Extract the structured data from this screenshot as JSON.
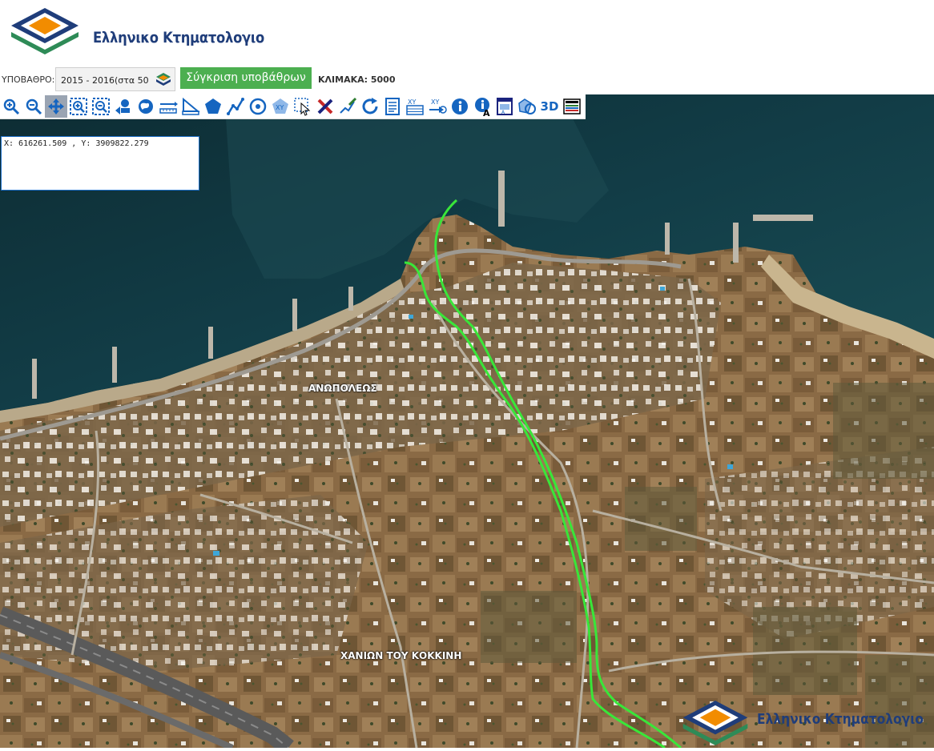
{
  "header": {
    "logo_text": "Ελληνικο Κτηματολογιο"
  },
  "basemap": {
    "label": "ΥΠΟΒΑΘΡΟ:",
    "selected": "2015 - 2016(στα 50",
    "compare_button": "Σύγκριση υποβάθρων",
    "scale": "ΚΛΙΜΑΚΑ: 5000"
  },
  "toolbar": {
    "tools": [
      {
        "name": "zoom-in-icon"
      },
      {
        "name": "zoom-out-icon"
      },
      {
        "name": "pan-icon",
        "active": true
      },
      {
        "name": "zoom-box-in-icon"
      },
      {
        "name": "zoom-box-out-icon"
      },
      {
        "name": "previous-extent-icon"
      },
      {
        "name": "full-extent-icon"
      },
      {
        "name": "measure-distance-icon"
      },
      {
        "name": "measure-angle-icon"
      },
      {
        "name": "measure-area-icon"
      },
      {
        "name": "draw-line-icon"
      },
      {
        "name": "draw-circle-icon"
      },
      {
        "name": "xy-polygon-icon"
      },
      {
        "name": "select-icon"
      },
      {
        "name": "clear-icon"
      },
      {
        "name": "edit-vertex-icon"
      },
      {
        "name": "refresh-icon"
      },
      {
        "name": "document-icon"
      },
      {
        "name": "xy-table-icon"
      },
      {
        "name": "goto-xy-icon"
      },
      {
        "name": "info-icon"
      },
      {
        "name": "info-text-icon"
      },
      {
        "name": "print-icon"
      },
      {
        "name": "layers-icon"
      },
      {
        "name": "3d-icon",
        "label": "3D"
      },
      {
        "name": "legend-icon"
      }
    ],
    "three_d_label": "3D"
  },
  "coords": {
    "text": "X: 616261.509 , Y: 3909822.279"
  },
  "map_labels": {
    "anopoleos": "ΑΝΩΠΟΛΕΩΣ",
    "chanion": "ΧΑΝΙΩΝ ΤΟΥ ΚΟΚΚΙΝΗ"
  },
  "watermark": {
    "text": "Ελληνικο Κτηματολογιο"
  },
  "colors": {
    "compare_button": "#4caf50",
    "route_line": "#39e639",
    "brand_blue": "#1f3d7a",
    "brand_orange": "#f28c00",
    "brand_green": "#2e8b57",
    "coords_border": "#1e6fc8"
  }
}
